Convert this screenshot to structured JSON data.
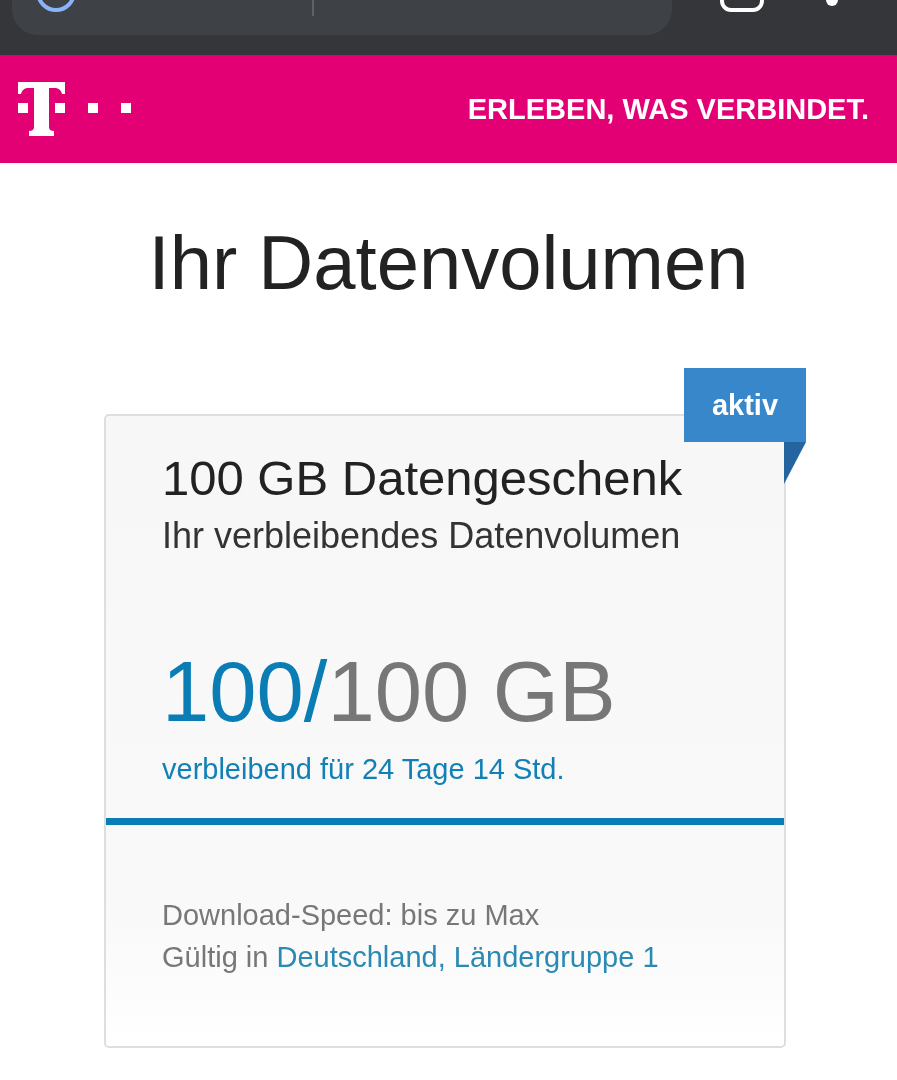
{
  "header": {
    "tagline": "ERLEBEN, WAS VERBINDET."
  },
  "page_title": "Ihr Datenvolumen",
  "pass": {
    "badge": "aktiv",
    "name": "100 GB Datengeschenk",
    "subtitle": "Ihr verbleibendes Datenvolumen",
    "reading": {
      "remaining": "100",
      "separator": "/",
      "total": "100 GB"
    },
    "time_left": "verbleibend für 24 Tage 14 Std.",
    "level": 1,
    "details": [
      {
        "kind": "text",
        "text": "Download-Speed: bis zu Max"
      },
      {
        "kind": "link",
        "text": "Gültig in",
        "link": "Deutschland, Ländergruppe 1"
      }
    ]
  }
}
